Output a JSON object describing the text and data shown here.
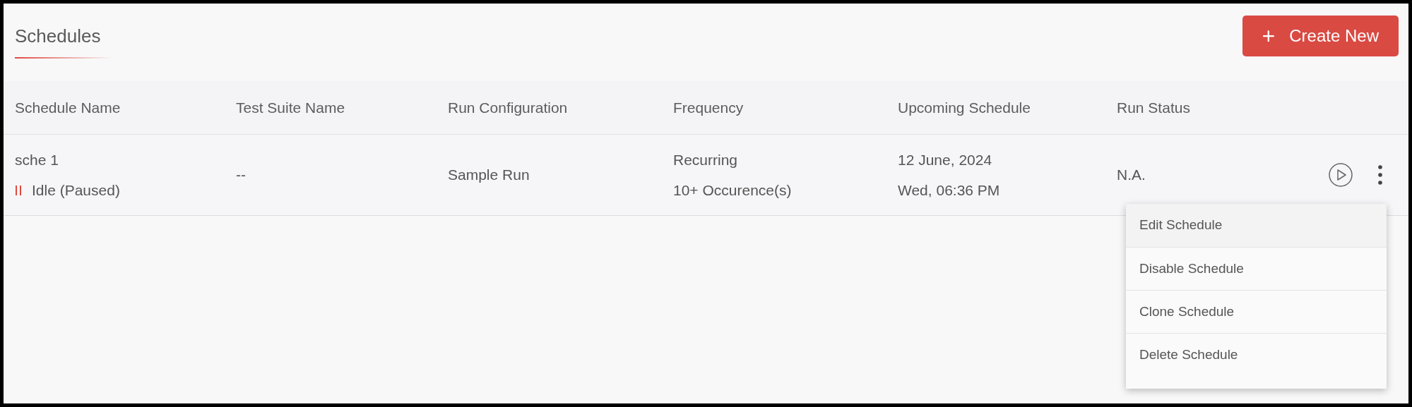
{
  "page": {
    "title": "Schedules"
  },
  "create_button": {
    "icon": "+",
    "label": "Create New"
  },
  "table": {
    "columns": [
      "Schedule Name",
      "Test Suite Name",
      "Run Configuration",
      "Frequency",
      "Upcoming Schedule",
      "Run Status"
    ],
    "rows": [
      {
        "name": "sche 1",
        "status": "Idle (Paused)",
        "paused": true,
        "test_suite": "--",
        "run_configuration": "Sample Run",
        "frequency": [
          "Recurring",
          "10+ Occurence(s)"
        ],
        "upcoming": [
          "12 June, 2024",
          "Wed, 06:36 PM"
        ],
        "run_status": "N.A.",
        "menu_open": true
      }
    ]
  },
  "row_menu": {
    "items": [
      {
        "label": "Edit Schedule",
        "highlighted": true
      },
      {
        "label": "Disable Schedule",
        "highlighted": false
      },
      {
        "label": "Clone Schedule",
        "highlighted": false
      },
      {
        "label": "Delete Schedule",
        "highlighted": false
      }
    ]
  }
}
